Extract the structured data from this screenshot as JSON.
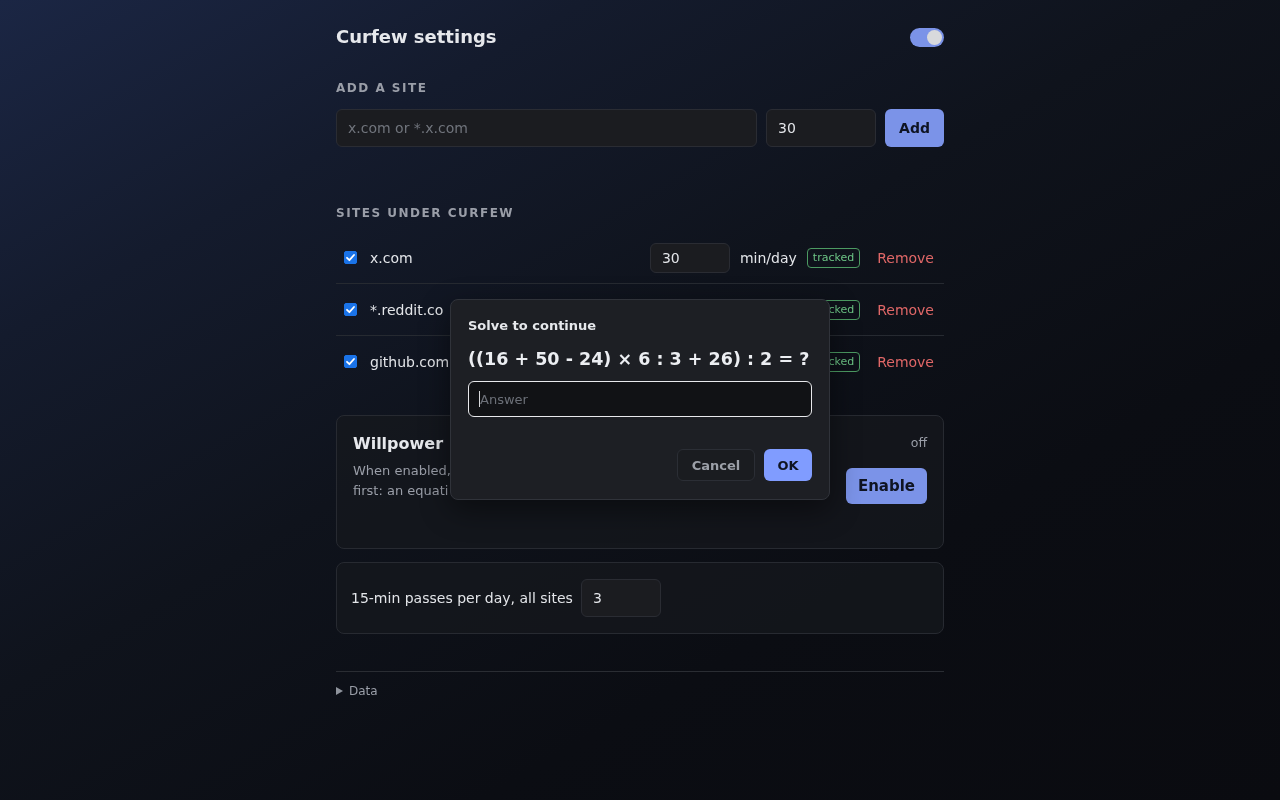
{
  "header": {
    "title": "Curfew settings",
    "enabled": true
  },
  "add_site": {
    "heading": "ADD A SITE",
    "site_field": {
      "placeholder": "x.com or *.x.com"
    },
    "minutes_field": {
      "value": "30"
    },
    "add_button": "Add"
  },
  "sites": {
    "heading": "SITES UNDER CURFEW",
    "rows": [
      {
        "name": "x.com",
        "checked": true,
        "minutes": "30",
        "unit": "min/day",
        "tag": "tracked",
        "remove": "Remove"
      },
      {
        "name": "*.reddit.co",
        "checked": true,
        "tag": "cked",
        "remove": "Remove"
      },
      {
        "name": "github.com",
        "checked": true,
        "tag": "cked",
        "remove": "Remove"
      }
    ]
  },
  "willpower": {
    "title": "Willpower",
    "description_lines": [
      "When enabled,",
      "first: an equati"
    ],
    "status": "off",
    "button": "Enable"
  },
  "passes": {
    "label": "15-min passes per day, all sites",
    "value": "3"
  },
  "data_section": {
    "label": "Data",
    "expanded": false
  },
  "dialog": {
    "title": "Solve to continue",
    "equation": "((16 + 50 - 24) × 6 : 3 + 26) : 2 = ?",
    "answer": {
      "placeholder": "Answer",
      "focused": true
    },
    "buttons": [
      {
        "label": "Cancel",
        "kind": "secondary"
      },
      {
        "label": "OK",
        "kind": "primary"
      }
    ]
  }
}
